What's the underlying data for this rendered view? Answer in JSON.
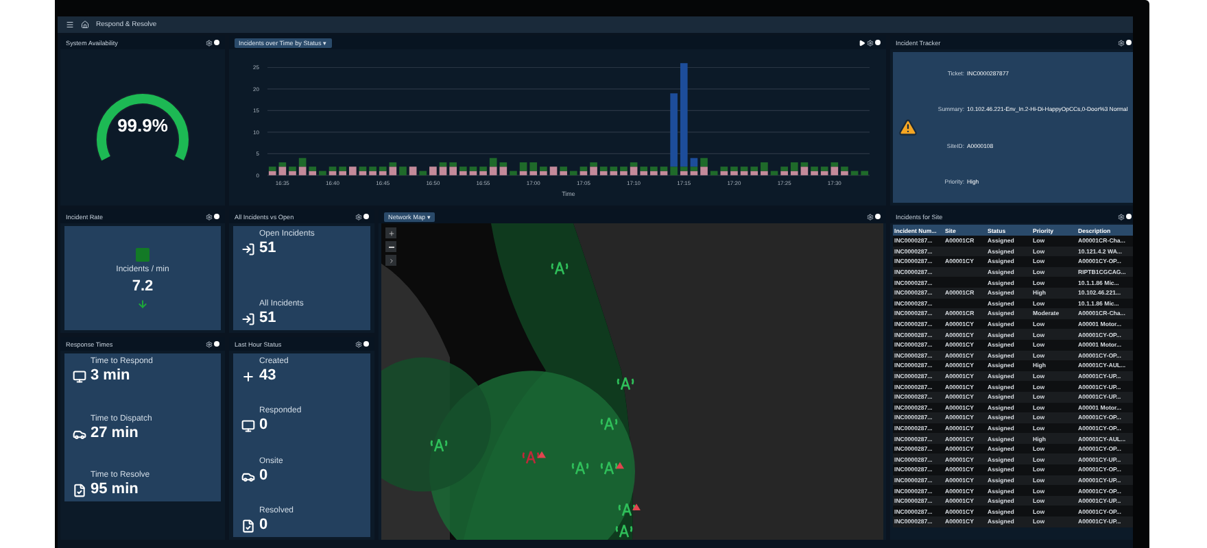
{
  "header": {
    "title": "Respond & Resolve"
  },
  "availability": {
    "title": "System Availability",
    "value": "99.9%",
    "level": 0.999
  },
  "incidents_chart": {
    "selector": "Incidents over Time by Status ▾",
    "chart_data": {
      "type": "bar",
      "stacked": true,
      "grid": true,
      "xlabel": "Time",
      "categories": [
        null,
        "16:35",
        null,
        null,
        null,
        null,
        "16:40",
        null,
        null,
        null,
        null,
        "16:45",
        null,
        null,
        null,
        null,
        "16:50",
        null,
        null,
        null,
        null,
        "16:55",
        null,
        null,
        null,
        null,
        "17:00",
        null,
        null,
        null,
        null,
        "17:05",
        null,
        null,
        null,
        null,
        "17:10",
        null,
        null,
        null,
        null,
        "17:15",
        null,
        null,
        null,
        null,
        "17:20",
        null,
        null,
        null,
        null,
        "17:25",
        null,
        null,
        null,
        null,
        "17:30",
        null,
        null,
        null
      ],
      "series": [
        {
          "color": "#c48a9a",
          "values": [
            1,
            2,
            1,
            2,
            1,
            0,
            1,
            1,
            2,
            1,
            1,
            1,
            2,
            0,
            2,
            0,
            2,
            2,
            2,
            1,
            1,
            1,
            2,
            2,
            0,
            1,
            1,
            1,
            2,
            1,
            0,
            1,
            2,
            1,
            1,
            1,
            2,
            1,
            1,
            1,
            0,
            1,
            1,
            2,
            0,
            1,
            1,
            1,
            1,
            1,
            0,
            1,
            1,
            2,
            1,
            1,
            2,
            1,
            0,
            0
          ]
        },
        {
          "color": "#1f6a2a",
          "values": [
            1,
            1,
            1,
            2,
            1,
            1,
            1,
            1,
            0,
            1,
            1,
            1,
            1,
            2,
            0,
            1,
            0,
            1,
            1,
            1,
            1,
            1,
            2,
            1,
            1,
            2,
            2,
            1,
            0,
            1,
            1,
            1,
            1,
            1,
            1,
            1,
            1,
            1,
            1,
            1,
            2,
            1,
            1,
            2,
            1,
            1,
            1,
            1,
            1,
            2,
            1,
            1,
            2,
            1,
            1,
            1,
            1,
            1,
            1,
            1
          ]
        },
        {
          "color": "#1d4d9a",
          "values": [
            0,
            0,
            0,
            0,
            0,
            0,
            0,
            0,
            0,
            0,
            0,
            0,
            0,
            0,
            0,
            0,
            0,
            0,
            0,
            0,
            0,
            0,
            0,
            0,
            0,
            0,
            0,
            0,
            0,
            0,
            0,
            0,
            0,
            0,
            0,
            0,
            0,
            0,
            0,
            0,
            17,
            24,
            2,
            0,
            0,
            0,
            0,
            0,
            0,
            0,
            0,
            0,
            0,
            0,
            0,
            0,
            0,
            0,
            0,
            0
          ]
        }
      ],
      "ylim": [
        0,
        26
      ],
      "yticks": [
        0,
        5,
        10,
        15,
        20,
        25
      ]
    }
  },
  "tracker": {
    "title": "Incident Tracker",
    "fields": [
      {
        "label": "Ticket:",
        "value": "INC0000287877"
      },
      {
        "label": "Summary:",
        "value": "10.102.46.221-Env_In.2-Hi-Di-HappyOpCCs,0-Door%3 Normal"
      },
      {
        "label": "SiteID:",
        "value": "A0000108"
      },
      {
        "label": "Priority:",
        "value": "High"
      }
    ]
  },
  "incident_rate": {
    "title": "Incident Rate",
    "label": "Incidents / min",
    "value": "7.2"
  },
  "all_incidents": {
    "title": "All Incidents vs Open",
    "items": [
      {
        "kind": "login",
        "label": "Open Incidents",
        "value": "51"
      },
      {
        "kind": "login",
        "label": "All Incidents",
        "value": "51"
      }
    ]
  },
  "network_map": {
    "selector": "Network Map ▾"
  },
  "response_times": {
    "title": "Response Times",
    "items": [
      {
        "kind": "monitor",
        "label": "Time to Respond",
        "value": "3 min"
      },
      {
        "kind": "car",
        "label": "Time to Dispatch",
        "value": "27 min"
      },
      {
        "kind": "document",
        "label": "Time to Resolve",
        "value": "95 min"
      }
    ]
  },
  "last_hour": {
    "title": "Last Hour Status",
    "items": [
      {
        "kind": "plus",
        "label": "Created",
        "value": "43"
      },
      {
        "kind": "monitor",
        "label": "Responded",
        "value": "0"
      },
      {
        "kind": "car",
        "label": "Onsite",
        "value": "0"
      },
      {
        "kind": "document",
        "label": "Resolved",
        "value": "0"
      }
    ]
  },
  "site_table": {
    "title": "Incidents for Site",
    "columns": [
      "Incident Num...",
      "Site",
      "Status",
      "Priority",
      "Description"
    ],
    "rows": [
      [
        "INC0000287...",
        "A00001CR",
        "Assigned",
        "Low",
        "A00001CR-Cha..."
      ],
      [
        "INC0000287...",
        "",
        "Assigned",
        "Low",
        "10.121.4.2 WA..."
      ],
      [
        "INC0000287...",
        "A00001CY",
        "Assigned",
        "Low",
        "A00001CY-OP..."
      ],
      [
        "INC0000287...",
        "",
        "Assigned",
        "Low",
        "RIPTB1CGCAG..."
      ],
      [
        "INC0000287...",
        "",
        "Assigned",
        "Low",
        "10.1.1.86 Mic..."
      ],
      [
        "INC0000287...",
        "A00001CR",
        "Assigned",
        "High",
        "10.102.46.221..."
      ],
      [
        "INC0000287...",
        "",
        "Assigned",
        "Low",
        "10.1.1.86 Mic..."
      ],
      [
        "INC0000287...",
        "A00001CR",
        "Assigned",
        "Moderate",
        "A00001CR-Cha..."
      ],
      [
        "INC0000287...",
        "A00001CY",
        "Assigned",
        "Low",
        "A00001 Motor..."
      ],
      [
        "INC0000287...",
        "A00001CY",
        "Assigned",
        "Low",
        "A00001CY-OP..."
      ],
      [
        "INC0000287...",
        "A00001CY",
        "Assigned",
        "Low",
        "A00001 Motor..."
      ],
      [
        "INC0000287...",
        "A00001CY",
        "Assigned",
        "Low",
        "A00001CY-OP..."
      ],
      [
        "INC0000287...",
        "A00001CY",
        "Assigned",
        "High",
        "A00001CY-AUL..."
      ],
      [
        "INC0000287...",
        "A00001CY",
        "Assigned",
        "Low",
        "A00001CY-UP..."
      ],
      [
        "INC0000287...",
        "A00001CY",
        "Assigned",
        "Low",
        "A00001CY-UP..."
      ],
      [
        "INC0000287...",
        "A00001CY",
        "Assigned",
        "Low",
        "A00001CY-UP..."
      ],
      [
        "INC0000287...",
        "A00001CY",
        "Assigned",
        "Low",
        "A00001 Motor..."
      ],
      [
        "INC0000287...",
        "A00001CY",
        "Assigned",
        "Low",
        "A00001CY-OP..."
      ],
      [
        "INC0000287...",
        "A00001CY",
        "Assigned",
        "Low",
        "A00001CY-OP..."
      ],
      [
        "INC0000287...",
        "A00001CY",
        "Assigned",
        "High",
        "A00001CY-AUL..."
      ],
      [
        "INC0000287...",
        "A00001CY",
        "Assigned",
        "Low",
        "A00001CY-OP..."
      ],
      [
        "INC0000287...",
        "A00001CY",
        "Assigned",
        "Low",
        "A00001CY-UP..."
      ],
      [
        "INC0000287...",
        "A00001CY",
        "Assigned",
        "Low",
        "A00001CY-OP..."
      ],
      [
        "INC0000287...",
        "A00001CY",
        "Assigned",
        "Low",
        "A00001CY-UP..."
      ],
      [
        "INC0000287...",
        "A00001CY",
        "Assigned",
        "Low",
        "A00001CY-OP..."
      ],
      [
        "INC0000287...",
        "A00001CY",
        "Assigned",
        "Low",
        "A00001CY-UP..."
      ],
      [
        "INC0000287...",
        "A00001CY",
        "Assigned",
        "Low",
        "A00001CY-OP..."
      ],
      [
        "INC0000287...",
        "A00001CY",
        "Assigned",
        "Low",
        "A00001CY-UP..."
      ]
    ]
  }
}
